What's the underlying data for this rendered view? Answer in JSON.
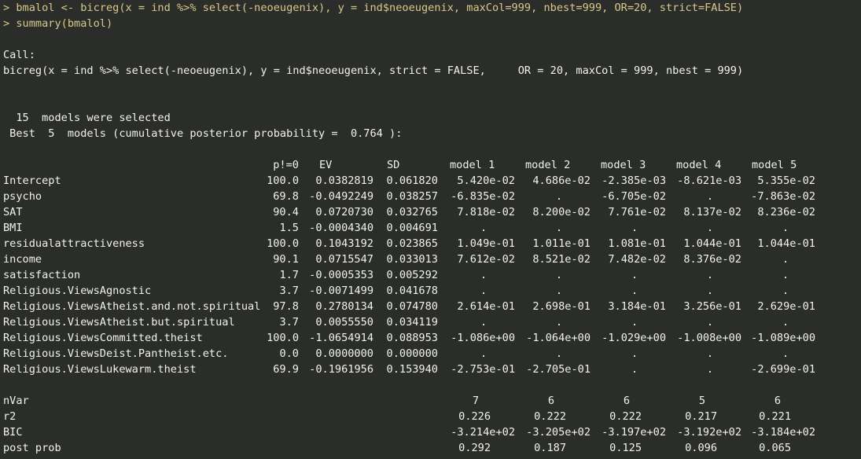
{
  "commands": [
    "> bmalol <- bicreg(x = ind %>% select(-neoeugenix), y = ind$neoeugenix, maxCol=999, nbest=999, OR=20, strict=FALSE)",
    "> summary(bmalol)"
  ],
  "call_header": "Call:",
  "call_text": "bicreg(x = ind %>% select(-neoeugenix), y = ind$neoeugenix, strict = FALSE,     OR = 20, maxCol = 999, nbest = 999)",
  "models_selected": "  15  models were selected",
  "best_models": " Best  5  models (cumulative posterior probability =  0.764 ):",
  "table_headers": [
    "p!=0",
    "EV",
    "SD",
    "model 1",
    "model 2",
    "model 3",
    "model 4",
    "model 5"
  ],
  "rows": [
    {
      "name": "Intercept",
      "p": "100.0",
      "ev": "0.0382819",
      "sd": "0.061820",
      "m": [
        "5.420e-02",
        "4.686e-02",
        "-2.385e-03",
        "-8.621e-03",
        "5.355e-02"
      ]
    },
    {
      "name": "psycho",
      "p": "69.8",
      "ev": "-0.0492249",
      "sd": "0.038257",
      "m": [
        "-6.835e-02",
        ".",
        "-6.705e-02",
        ".",
        "-7.863e-02"
      ]
    },
    {
      "name": "SAT",
      "p": "90.4",
      "ev": "0.0720730",
      "sd": "0.032765",
      "m": [
        "7.818e-02",
        "8.200e-02",
        "7.761e-02",
        "8.137e-02",
        "8.236e-02"
      ]
    },
    {
      "name": "BMI",
      "p": "1.5",
      "ev": "-0.0004340",
      "sd": "0.004691",
      "m": [
        ".",
        ".",
        ".",
        ".",
        "."
      ]
    },
    {
      "name": "residualattractiveness",
      "p": "100.0",
      "ev": "0.1043192",
      "sd": "0.023865",
      "m": [
        "1.049e-01",
        "1.011e-01",
        "1.081e-01",
        "1.044e-01",
        "1.044e-01"
      ]
    },
    {
      "name": "income",
      "p": "90.1",
      "ev": "0.0715547",
      "sd": "0.033013",
      "m": [
        "7.612e-02",
        "8.521e-02",
        "7.482e-02",
        "8.376e-02",
        "."
      ]
    },
    {
      "name": "satisfaction",
      "p": "1.7",
      "ev": "-0.0005353",
      "sd": "0.005292",
      "m": [
        ".",
        ".",
        ".",
        ".",
        "."
      ]
    },
    {
      "name": "Religious.ViewsAgnostic",
      "p": "3.7",
      "ev": "-0.0071499",
      "sd": "0.041678",
      "m": [
        ".",
        ".",
        ".",
        ".",
        "."
      ]
    },
    {
      "name": "Religious.ViewsAtheist.and.not.spiritual",
      "p": "97.8",
      "ev": "0.2780134",
      "sd": "0.074780",
      "m": [
        "2.614e-01",
        "2.698e-01",
        "3.184e-01",
        "3.256e-01",
        "2.629e-01"
      ]
    },
    {
      "name": "Religious.ViewsAtheist.but.spiritual",
      "p": "3.7",
      "ev": "0.0055550",
      "sd": "0.034119",
      "m": [
        ".",
        ".",
        ".",
        ".",
        "."
      ]
    },
    {
      "name": "Religious.ViewsCommitted.theist",
      "p": "100.0",
      "ev": "-1.0654914",
      "sd": "0.088953",
      "m": [
        "-1.086e+00",
        "-1.064e+00",
        "-1.029e+00",
        "-1.008e+00",
        "-1.089e+00"
      ]
    },
    {
      "name": "Religious.ViewsDeist.Pantheist.etc.",
      "p": "0.0",
      "ev": "0.0000000",
      "sd": "0.000000",
      "m": [
        ".",
        ".",
        ".",
        ".",
        "."
      ]
    },
    {
      "name": "Religious.ViewsLukewarm.theist",
      "p": "69.9",
      "ev": "-0.1961956",
      "sd": "0.153940",
      "m": [
        "-2.753e-01",
        "-2.705e-01",
        ".",
        ".",
        "-2.699e-01"
      ]
    }
  ],
  "summary_rows": [
    {
      "name": "nVar",
      "m": [
        "7",
        "6",
        "6",
        "5",
        "6"
      ]
    },
    {
      "name": "r2",
      "m": [
        "0.226",
        "0.222",
        "0.222",
        "0.217",
        "0.221"
      ]
    },
    {
      "name": "BIC",
      "m": [
        "-3.214e+02",
        "-3.205e+02",
        "-3.197e+02",
        "-3.192e+02",
        "-3.184e+02"
      ]
    },
    {
      "name": "post prob",
      "m": [
        "0.292",
        "0.187",
        "0.125",
        "0.096",
        "0.065"
      ]
    }
  ],
  "colors": {
    "background": "#2b2d2a",
    "text": "#f2f2ee",
    "prompt": "#d8c98a"
  }
}
